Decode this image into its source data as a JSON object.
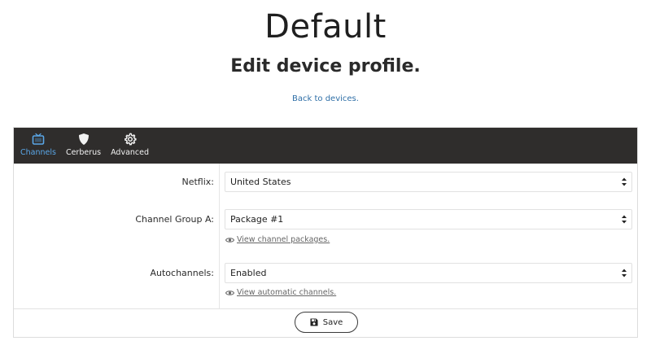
{
  "page": {
    "title": "Default",
    "subtitle": "Edit device profile.",
    "back_link": "Back to devices."
  },
  "tabs": [
    {
      "label": "Channels",
      "icon": "tv-icon",
      "active": true
    },
    {
      "label": "Cerberus",
      "icon": "shield-icon",
      "active": false
    },
    {
      "label": "Advanced",
      "icon": "gear-icon",
      "active": false
    }
  ],
  "form": {
    "netflix": {
      "label": "Netflix:",
      "value": "United States"
    },
    "channel_group_a": {
      "label": "Channel Group A:",
      "value": "Package #1",
      "helper": "View channel packages."
    },
    "autochannels": {
      "label": "Autochannels:",
      "value": "Enabled",
      "helper": "View automatic channels."
    }
  },
  "actions": {
    "save_label": "Save"
  },
  "colors": {
    "tabbar_bg": "#2f2d2c",
    "active_tab": "#5aa7e8",
    "link": "#2f6fa7"
  }
}
